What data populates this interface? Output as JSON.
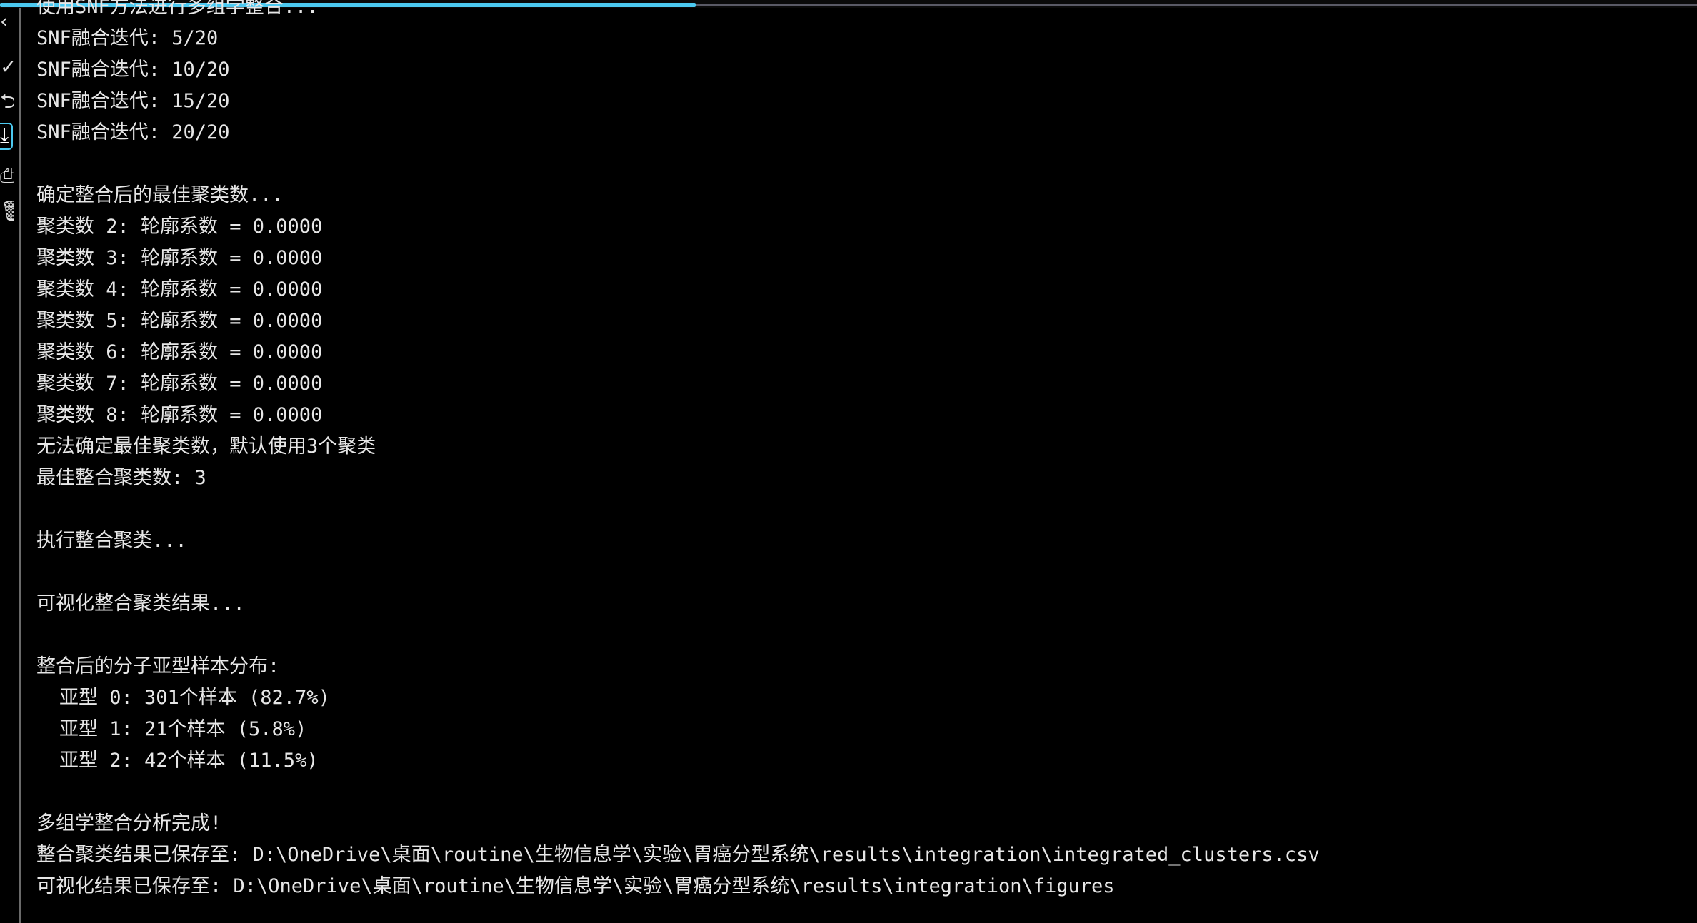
{
  "progress": {
    "fraction": 0.41
  },
  "gutter_icons": [
    {
      "name": "chevron-left-icon",
      "glyph": "‹"
    },
    {
      "name": "check-icon",
      "glyph": "✓"
    },
    {
      "name": "wrap-icon",
      "glyph": "⮌"
    },
    {
      "name": "scroll-to-end-icon",
      "glyph": "⤓",
      "active": true
    },
    {
      "name": "print-icon",
      "glyph": "⎙"
    },
    {
      "name": "trash-icon",
      "glyph": "🗑"
    }
  ],
  "console": {
    "lines": [
      {
        "text": "使用SNF方法进行多组学整合..."
      },
      {
        "text": "SNF融合迭代: 5/20"
      },
      {
        "text": "SNF融合迭代: 10/20"
      },
      {
        "text": "SNF融合迭代: 15/20"
      },
      {
        "text": "SNF融合迭代: 20/20"
      },
      {
        "text": ""
      },
      {
        "text": "确定整合后的最佳聚类数..."
      },
      {
        "text": "聚类数 2: 轮廓系数 = 0.0000"
      },
      {
        "text": "聚类数 3: 轮廓系数 = 0.0000"
      },
      {
        "text": "聚类数 4: 轮廓系数 = 0.0000"
      },
      {
        "text": "聚类数 5: 轮廓系数 = 0.0000"
      },
      {
        "text": "聚类数 6: 轮廓系数 = 0.0000"
      },
      {
        "text": "聚类数 7: 轮廓系数 = 0.0000"
      },
      {
        "text": "聚类数 8: 轮廓系数 = 0.0000"
      },
      {
        "text": "无法确定最佳聚类数，默认使用3个聚类"
      },
      {
        "text": "最佳整合聚类数: 3"
      },
      {
        "text": ""
      },
      {
        "text": "执行整合聚类..."
      },
      {
        "text": ""
      },
      {
        "text": "可视化整合聚类结果..."
      },
      {
        "text": ""
      },
      {
        "text": "整合后的分子亚型样本分布:"
      },
      {
        "text": "亚型 0: 301个样本 (82.7%)",
        "indent": true
      },
      {
        "text": "亚型 1: 21个样本 (5.8%)",
        "indent": true
      },
      {
        "text": "亚型 2: 42个样本 (11.5%)",
        "indent": true
      },
      {
        "text": ""
      },
      {
        "text": "多组学整合分析完成!"
      },
      {
        "text": "整合聚类结果已保存至: D:\\OneDrive\\桌面\\routine\\生物信息学\\实验\\胃癌分型系统\\results\\integration\\integrated_clusters.csv"
      },
      {
        "text": "可视化结果已保存至: D:\\OneDrive\\桌面\\routine\\生物信息学\\实验\\胃癌分型系统\\results\\integration\\figures"
      }
    ]
  },
  "colors": {
    "background": "#000000",
    "text": "#e6e6e6",
    "accent": "#4cc9f0",
    "divider": "#6a6a6a"
  }
}
